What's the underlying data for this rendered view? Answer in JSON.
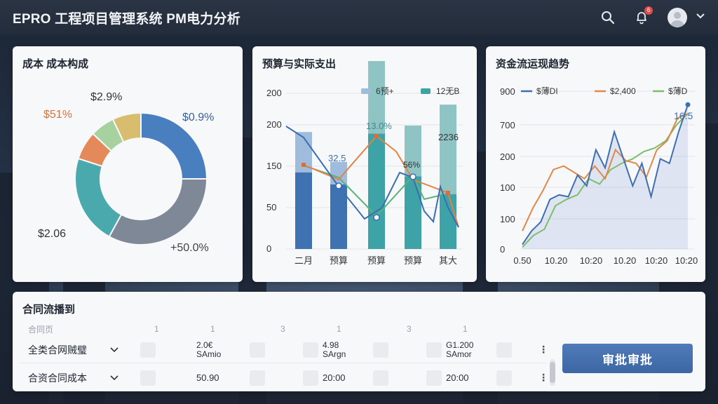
{
  "header": {
    "app_title": "EPRO 工程项目管理系统 PM电力分析",
    "notification_count": "6"
  },
  "cost_card": {
    "title": "成本 成本构成",
    "labels": [
      "$0.9%",
      "+50.0%",
      "$2.06",
      "$51%",
      "$2.9%"
    ],
    "chart_data": {
      "type": "pie",
      "slices": [
        {
          "label": "$0.9%",
          "value": 25,
          "color": "#4a7fbf"
        },
        {
          "label": "+50.0%",
          "value": 33,
          "color": "#7f8897"
        },
        {
          "label": "$2.06",
          "value": 22,
          "color": "#49a9ad"
        },
        {
          "label": "$51%",
          "value": 7,
          "color": "#e48a5a"
        },
        {
          "label": "",
          "value": 6,
          "color": "#a8d1a0"
        },
        {
          "label": "$2.9%",
          "value": 7,
          "color": "#d9bd6e"
        }
      ]
    }
  },
  "budget_card": {
    "title": "预算与实际支出",
    "legend": [
      "6预+",
      "12无B"
    ],
    "annotations": [
      "32.5",
      "13.0%",
      "56%",
      "2236"
    ],
    "chart_data": {
      "type": "bar",
      "categories": [
        "二月",
        "预算",
        "预算",
        "预算",
        "其大"
      ],
      "y_ticks": [
        0,
        50,
        150,
        200,
        200
      ],
      "ylim": [
        0,
        200
      ],
      "series": [
        {
          "name": "6预+",
          "values": [
            95,
            80,
            143,
            90,
            68
          ],
          "color": "#3f78b5"
        },
        {
          "name": "12无B",
          "values": [
            50,
            28,
            90,
            63,
            111
          ],
          "color": "#9fc0dc"
        }
      ],
      "line_blue": [
        196,
        98,
        77,
        29,
        102,
        58,
        28
      ],
      "line_green": [
        112,
        76,
        57,
        94,
        73,
        82
      ],
      "line_orange": [
        116,
        140,
        119,
        82,
        22
      ]
    }
  },
  "cashflow_card": {
    "title": "资金流运现趋势",
    "legend": [
      "$薄DI",
      "$2,400",
      "$薄D"
    ],
    "peak_label": "16.5",
    "chart_data": {
      "type": "line",
      "x_ticks": [
        "0.50",
        "10.20",
        "10:20",
        "10.20",
        "10:20",
        "10:20"
      ],
      "y_ticks": [
        0,
        100,
        100,
        200,
        700,
        900
      ],
      "series": [
        {
          "name": "$薄DI",
          "color": "#3f6fb0",
          "values": [
            5,
            20,
            30,
            55,
            60,
            58,
            82,
            70,
            110,
            90,
            130,
            100,
            70,
            95,
            58,
            100,
            95,
            130,
            160
          ]
        },
        {
          "name": "$2,400",
          "color": "#e0884a",
          "values": [
            20,
            45,
            65,
            88,
            92,
            85,
            78,
            92,
            78,
            110,
            98,
            95,
            80,
            110,
            120,
            145,
            150
          ]
        },
        {
          "name": "$薄D",
          "color": "#7cbf6a",
          "values": [
            2,
            15,
            22,
            48,
            55,
            60,
            78,
            72,
            88,
            95,
            100,
            108,
            112,
            120,
            138,
            150
          ]
        }
      ]
    }
  },
  "contract_card": {
    "title": "合同流播到",
    "header_cols": [
      "合同页",
      "1",
      "1",
      "3",
      "1",
      "3",
      "1"
    ],
    "rows": [
      {
        "name": "全类合网贼璧",
        "col1": "2.0€\nSAmio",
        "col2": "4.98\nSArgn",
        "col3": "G1.200\nSAmor"
      },
      {
        "name": "合资合同成本",
        "col1": "50.90",
        "col2": "20:00",
        "col3": "20:00"
      }
    ],
    "approve_label": "审批审批"
  }
}
